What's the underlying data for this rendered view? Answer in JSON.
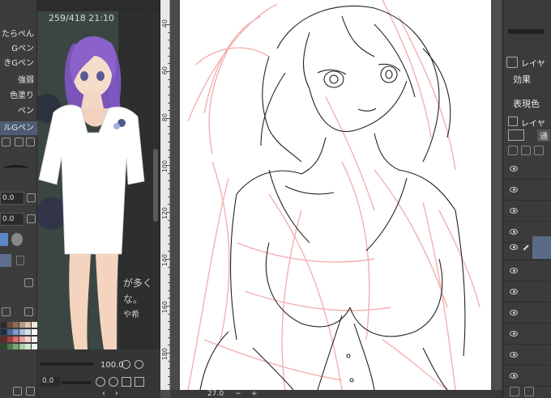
{
  "left_panel": {
    "brushes": [
      "たらぺん",
      "Gペン",
      "きGペン",
      "強弱",
      "色塗り",
      "ペン",
      "ルGペン"
    ],
    "values": [
      "0.0",
      "0.0"
    ]
  },
  "reference": {
    "header": "259/418 21:10",
    "zoom": "100.0",
    "rotation": "0.0",
    "bg_text_1": "が多く",
    "bg_text_2": "な。",
    "bg_text_3": "や希"
  },
  "ruler": {
    "labels": [
      "40",
      "60",
      "80",
      "100",
      "120",
      "140",
      "160",
      "180"
    ]
  },
  "canvas": {
    "status_zoom": "27.0"
  },
  "right_panel": {
    "tab_label": "レイヤ",
    "effect_label": "効果",
    "expression_label": "表現色",
    "layer_tab_label": "レイヤ",
    "layer_mode_label": "通"
  },
  "colors": {
    "rough_sketch": "#f2a8a8",
    "lineart": "#222222",
    "selected_layer": "#5a6b86",
    "hair": "#8a62c9"
  }
}
